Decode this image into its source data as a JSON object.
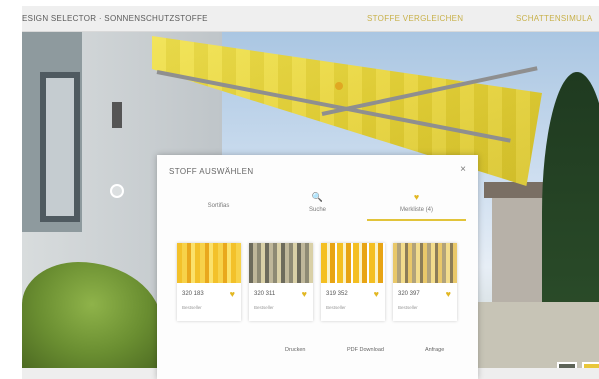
{
  "header": {
    "app_title": "esign Selector · SONNENSCHUTZSTOFFE",
    "nav": {
      "compare": "STOFFE VERGLEICHEN",
      "shadow": "SCHATTENSIMULA"
    }
  },
  "modal": {
    "title": "STOFF AUSWÄHLEN",
    "close": "×",
    "tabs": [
      {
        "label": "Sortifias",
        "icon": ""
      },
      {
        "label": "Suche",
        "icon": "🔍"
      },
      {
        "label": "Merkliste (4)",
        "icon": "♥"
      }
    ],
    "fabrics": [
      {
        "code": "320 183",
        "sub": "Bestseller"
      },
      {
        "code": "320 311",
        "sub": "Bestseller"
      },
      {
        "code": "319 352",
        "sub": "Bestseller"
      },
      {
        "code": "320 397",
        "sub": "Bestseller"
      }
    ],
    "actions": {
      "print": "Drucken",
      "pdf": "PDF Download",
      "request": "Anfrage"
    }
  },
  "footer": {
    "left": "",
    "right": ""
  },
  "colors": {
    "accent": "#e2c43a",
    "awning": "#e7d337"
  }
}
